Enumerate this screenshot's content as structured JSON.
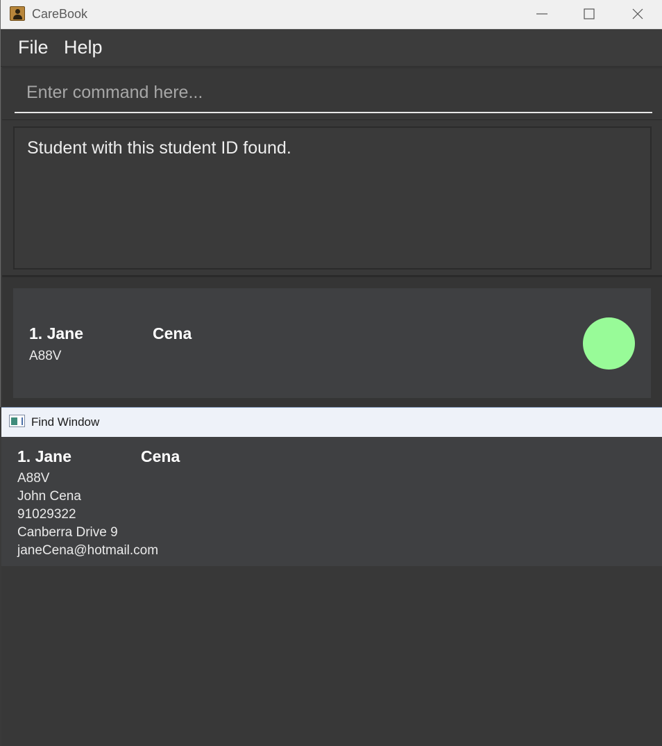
{
  "main_window": {
    "title": "CareBook",
    "menu": {
      "file_label": "File",
      "help_label": "Help"
    },
    "command": {
      "value": "",
      "placeholder": "Enter command here..."
    },
    "result": {
      "message": "Student with this student ID found."
    },
    "person_list": [
      {
        "index_name": "1. Jane",
        "surname": "Cena",
        "student_id": "A88V",
        "status_color": "#98fb98"
      }
    ]
  },
  "find_window": {
    "title": "Find Window",
    "person": {
      "index_name": "1. Jane",
      "surname": "Cena",
      "student_id": "A88V",
      "guardian": "John Cena",
      "phone": "91029322",
      "address": "Canberra Drive 9",
      "email": "janeCena@hotmail.com"
    }
  },
  "colors": {
    "background": "#3c3c3c",
    "card": "#3f4042",
    "status_green": "#98fb98"
  },
  "icons": {
    "app": "contact-book-icon",
    "minimize": "minimize-icon",
    "maximize": "maximize-icon",
    "close": "close-icon",
    "find_window": "window-icon"
  }
}
